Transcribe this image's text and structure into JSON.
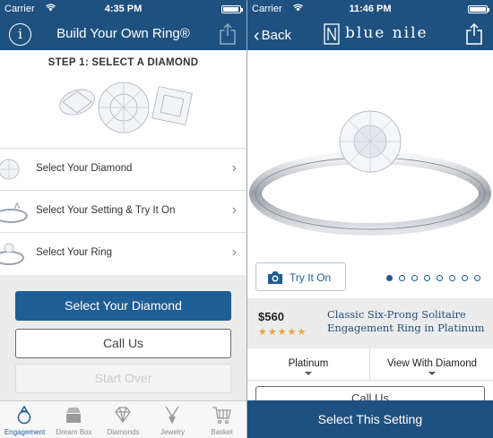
{
  "left": {
    "status": {
      "carrier": "Carrier",
      "time": "4:35 PM",
      "battery_level": 0.85
    },
    "navbar": {
      "info_label": "i",
      "title": "Build Your Own Ring®"
    },
    "step_title": "STEP 1: SELECT A DIAMOND",
    "rows": [
      {
        "label": "Select Your Diamond"
      },
      {
        "label": "Select Your Setting & Try It On"
      },
      {
        "label": "Select Your Ring"
      }
    ],
    "buttons": {
      "primary": "Select Your Diamond",
      "call": "Call Us",
      "start_over": "Start Over"
    },
    "tabs": [
      {
        "label": "Engagement",
        "icon": "ring-icon",
        "active": true
      },
      {
        "label": "Dream Box",
        "icon": "box-icon",
        "active": false
      },
      {
        "label": "Diamonds",
        "icon": "diamond-icon",
        "active": false
      },
      {
        "label": "Jewelry",
        "icon": "necklace-icon",
        "active": false
      },
      {
        "label": "Basket",
        "icon": "cart-icon",
        "active": false
      }
    ]
  },
  "right": {
    "status": {
      "carrier": "Carrier",
      "time": "11:46 PM",
      "battery_level": 0.9
    },
    "navbar": {
      "back_label": "Back",
      "brand": "blue nile"
    },
    "try_on_label": "Try It On",
    "carousel": {
      "total": 8,
      "active_index": 0
    },
    "price": "$560",
    "rating_stars": "★★★★★",
    "product_name": "Classic Six-Prong Solitaire Engagement Ring in Platinum",
    "metal_selector": "Platinum",
    "view_selector": "View With Diamond",
    "call_peek": "Call Us",
    "cta": "Select This Setting"
  },
  "colors": {
    "navbar": "#1f5180",
    "primary_button": "#1f5d95",
    "star": "#e7a43a",
    "band": "#ececec"
  }
}
